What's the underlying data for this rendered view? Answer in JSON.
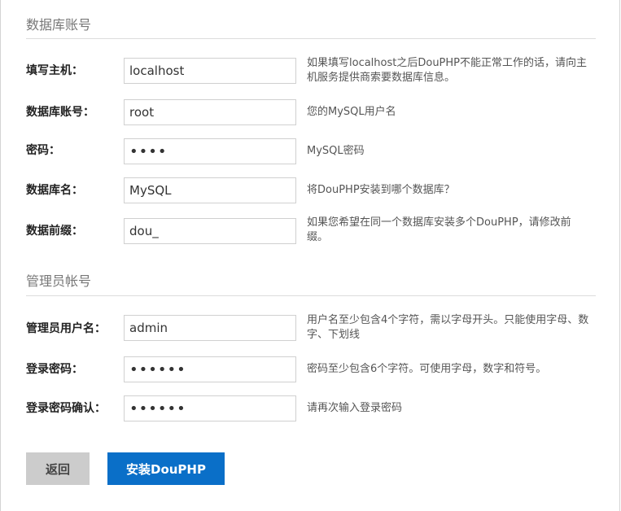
{
  "db_section": {
    "title": "数据库账号",
    "fields": [
      {
        "label": "填写主机：",
        "value": "localhost",
        "type": "text",
        "help": "如果填写localhost之后DouPHP不能正常工作的话，请向主机服务提供商索要数据库信息。"
      },
      {
        "label": "数据库账号：",
        "value": "root",
        "type": "text",
        "help": "您的MySQL用户名"
      },
      {
        "label": "密码：",
        "value": "••••",
        "type": "password",
        "help": "MySQL密码"
      },
      {
        "label": "数据库名：",
        "value": "MySQL",
        "type": "text",
        "help": "将DouPHP安装到哪个数据库？"
      },
      {
        "label": "数据前缀：",
        "value": "dou_",
        "type": "text",
        "help": "如果您希望在同一个数据库安装多个DouPHP，请修改前缀。"
      }
    ]
  },
  "admin_section": {
    "title": "管理员帐号",
    "fields": [
      {
        "label": "管理员用户名：",
        "value": "admin",
        "type": "text",
        "help": "用户名至少包含4个字符，需以字母开头。只能使用字母、数字、下划线"
      },
      {
        "label": "登录密码：",
        "value": "••••••",
        "type": "password",
        "help": "密码至少包含6个字符。可使用字母，数字和符号。"
      },
      {
        "label": "登录密码确认：",
        "value": "••••••",
        "type": "password",
        "help": "请再次输入登录密码"
      }
    ]
  },
  "buttons": {
    "back_label": "返回",
    "install_label": "安装DouPHP"
  },
  "colors": {
    "install_button": "#0a6fc8",
    "back_button": "#cccccc"
  }
}
